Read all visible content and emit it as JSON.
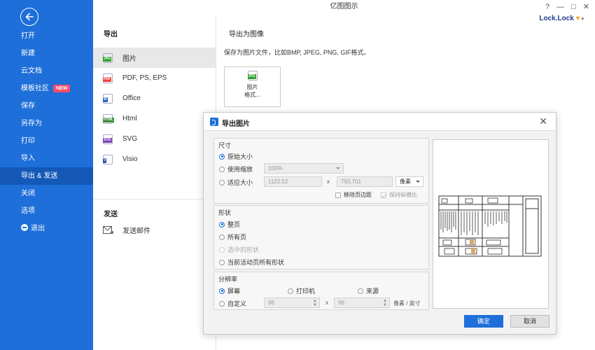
{
  "window": {
    "title": "亿图图示",
    "brand": "Lock.Lock",
    "controls": [
      "?",
      "—",
      "□",
      "✕"
    ]
  },
  "sidebar": {
    "items": [
      {
        "label": "打开"
      },
      {
        "label": "新建"
      },
      {
        "label": "云文档"
      },
      {
        "label": "模板社区",
        "badge": "NEW"
      },
      {
        "label": "保存"
      },
      {
        "label": "另存为"
      },
      {
        "label": "打印"
      },
      {
        "label": "导入"
      },
      {
        "label": "导出 & 发送",
        "active": true
      },
      {
        "label": "关闭"
      },
      {
        "label": "选项"
      },
      {
        "label": "退出"
      }
    ]
  },
  "export_panel": {
    "heading": "导出",
    "items": [
      {
        "label": "图片",
        "icon": "JPG",
        "color": "#2ca02c",
        "active": true
      },
      {
        "label": "PDF, PS, EPS",
        "icon": "PDF",
        "color": "#e8453c"
      },
      {
        "label": "Office",
        "icon": "W",
        "color": "#2b63c9"
      },
      {
        "label": "Html",
        "icon": "HTML",
        "color": "#3a8a3a"
      },
      {
        "label": "SVG",
        "icon": "SVG",
        "color": "#7b3fb5"
      },
      {
        "label": "Visio",
        "icon": "V",
        "color": "#2b4fb5"
      }
    ],
    "send_heading": "发送",
    "send_item": "发送邮件"
  },
  "content": {
    "heading": "导出为图像",
    "desc": "保存为图片文件，比如BMP, JPEG, PNG, GIF格式。",
    "card_line1": "图片",
    "card_line2": "格式..."
  },
  "dialog": {
    "title": "导出图片",
    "size_group": {
      "title": "尺寸",
      "original": "原始大小",
      "zoom": "使用缩放",
      "zoom_value": "100%",
      "fit": "适应大小",
      "width": "1122.52",
      "height": "793.701",
      "times": "x",
      "unit": "像素",
      "remove_margin": "移除页边距",
      "keep_ratio": "保持纵横比"
    },
    "shape_group": {
      "title": "形状",
      "whole_page": "整页",
      "all_pages": "所有页",
      "selected": "选中的形状",
      "active_page": "当前活动页所有形状"
    },
    "res_group": {
      "title": "分辨率",
      "screen": "屏幕",
      "printer": "打印机",
      "source": "来源",
      "custom": "自定义",
      "x_value": "96",
      "y_value": "96",
      "times": "x",
      "unit": "像素 / 英寸"
    },
    "ok": "确定",
    "cancel": "取消"
  }
}
